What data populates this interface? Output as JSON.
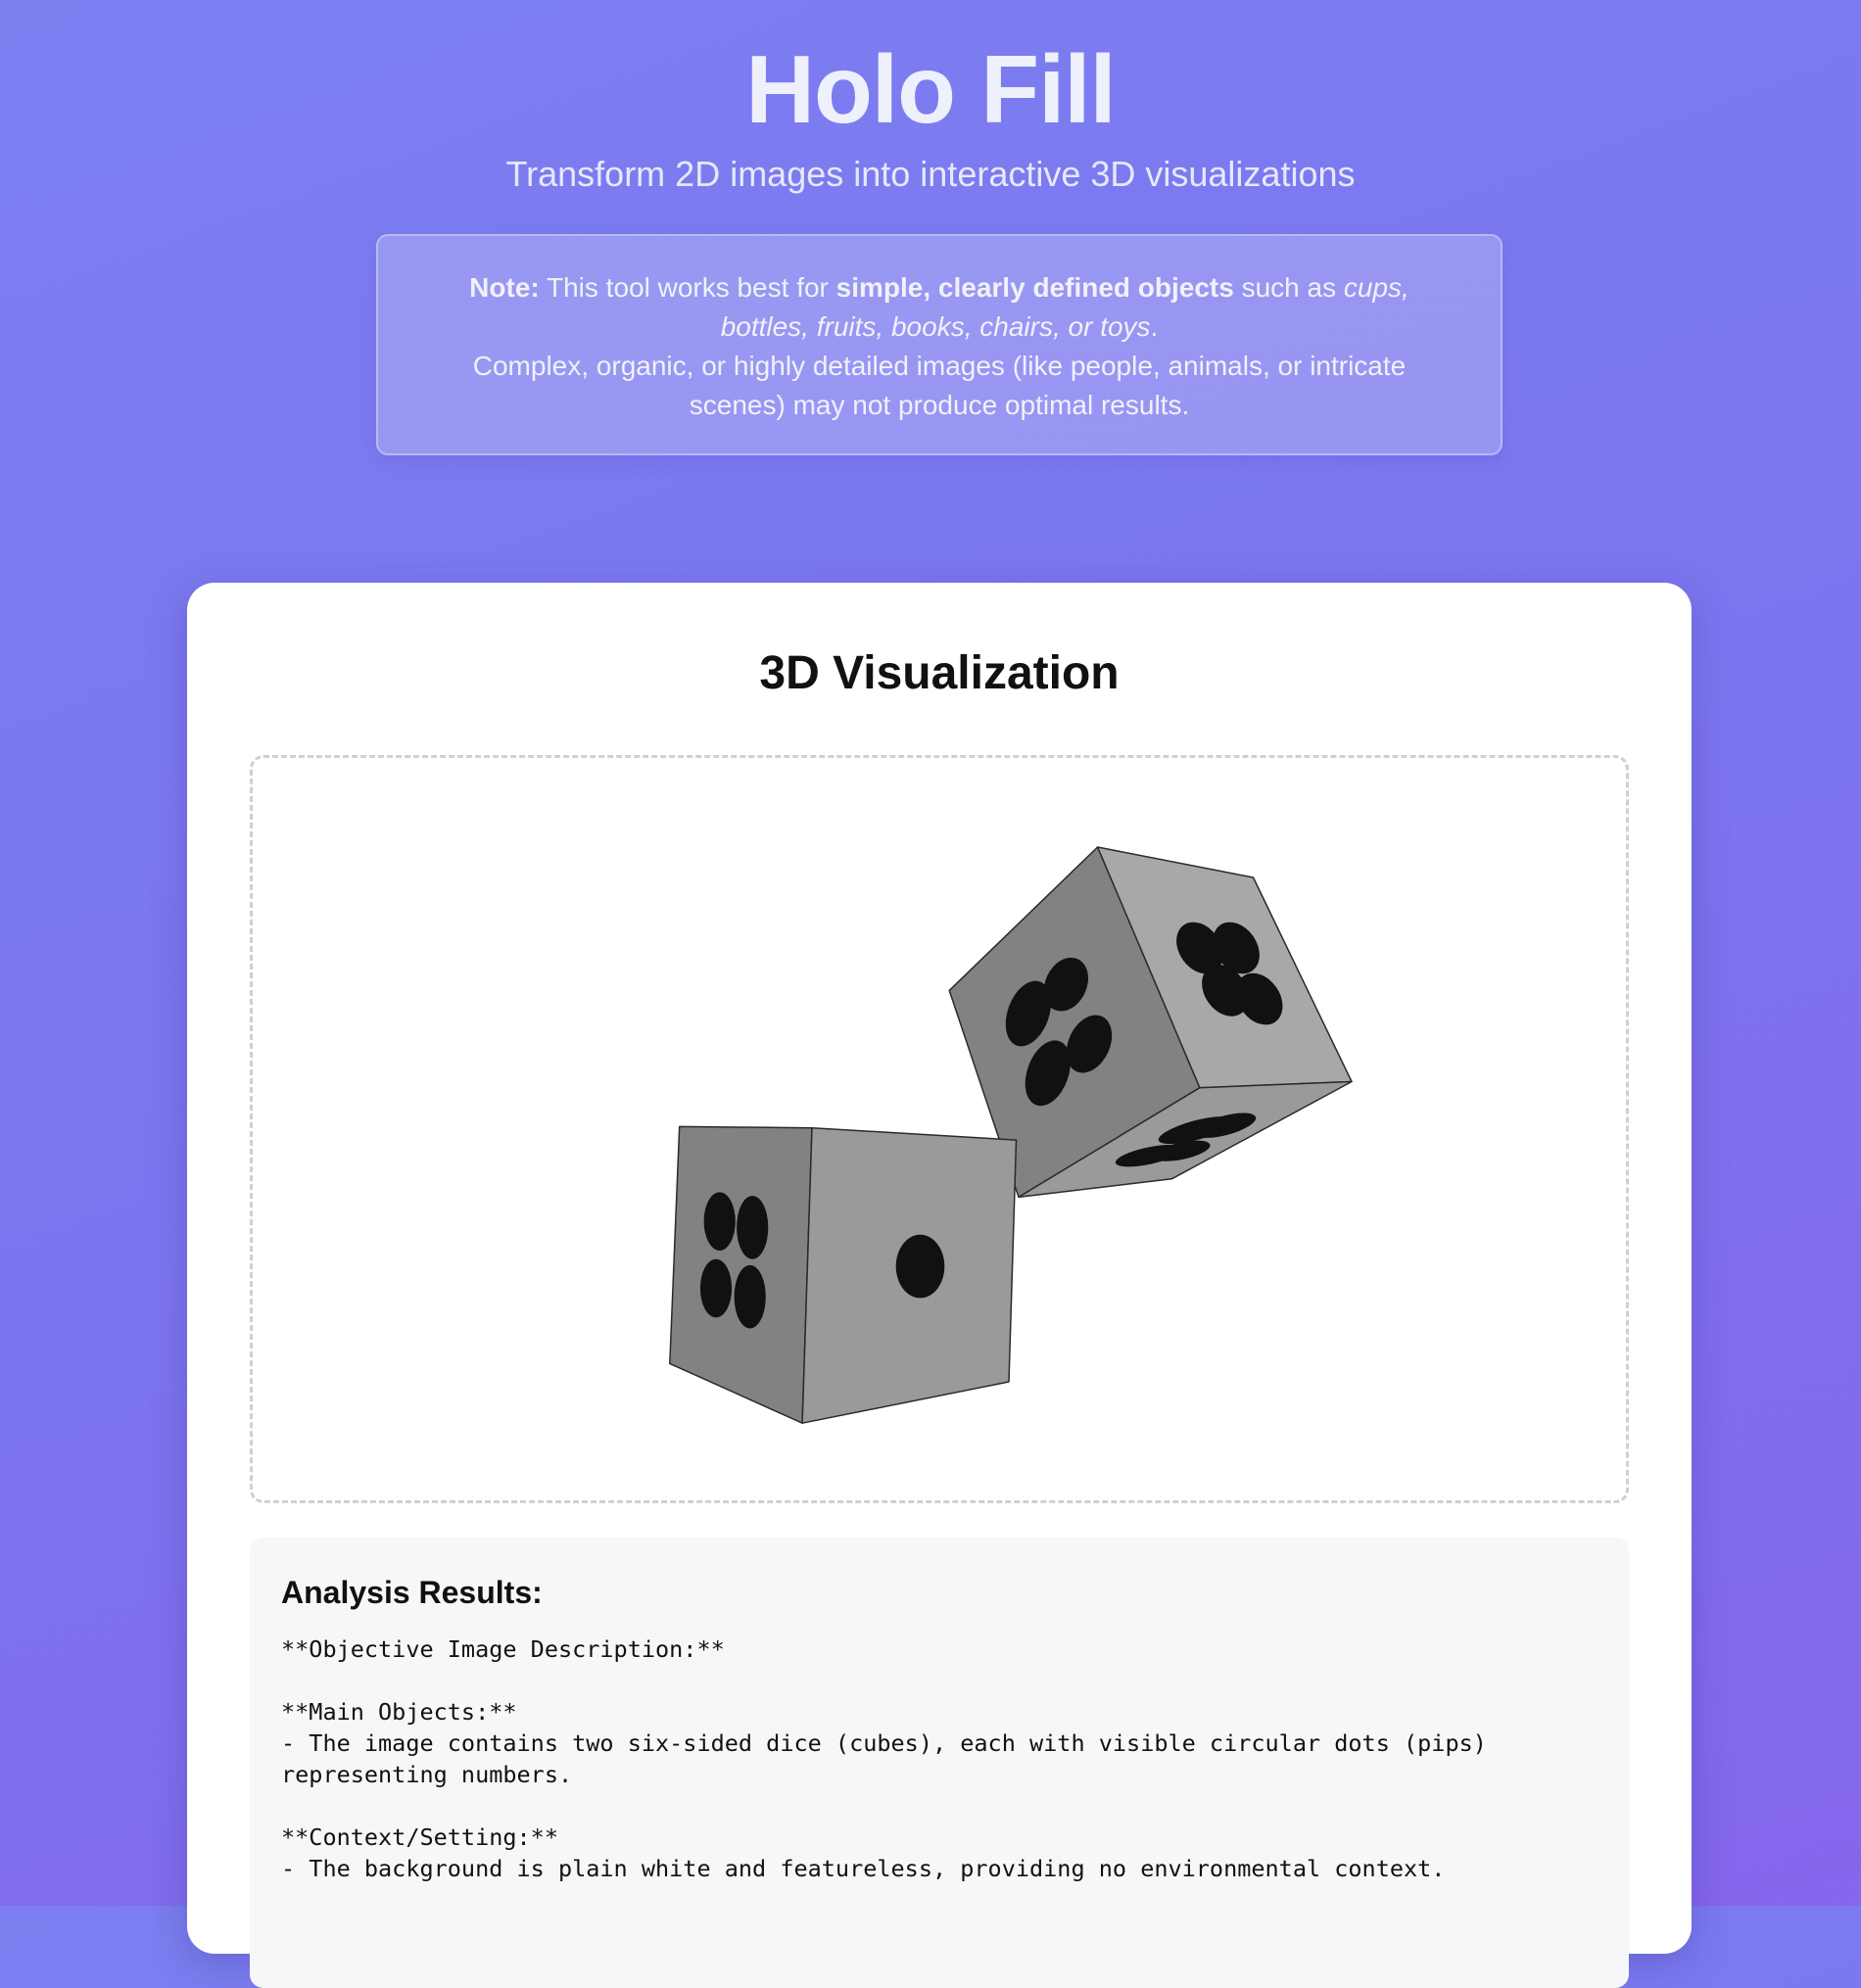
{
  "app": {
    "title": "Holo Fill",
    "subtitle": "Transform 2D images into interactive 3D visualizations"
  },
  "note": {
    "label": "Note:",
    "text1": " This tool works best for ",
    "emphasis": "simple, clearly defined objects",
    "text2": " such as ",
    "examples": "cups, bottles, fruits, books, chairs, or toys",
    "text3": ".",
    "line2": "Complex, organic, or highly detailed images (like people, animals, or intricate scenes) may not produce optimal results."
  },
  "visualization": {
    "title": "3D Visualization",
    "colors": {
      "face_dark": "#828282",
      "face_mid": "#9a9a9a",
      "face_light": "#a8a8a8",
      "pip": "#111111",
      "edge": "#2a2a2a"
    }
  },
  "analysis": {
    "title": "Analysis Results:",
    "lines": [
      "**Objective Image Description:**",
      "",
      "**Main Objects:**",
      "- The image contains two six-sided dice (cubes), each with visible circular dots (pips)",
      "representing numbers.",
      "",
      "**Context/Setting:**",
      "- The background is plain white and featureless, providing no environmental context."
    ]
  }
}
